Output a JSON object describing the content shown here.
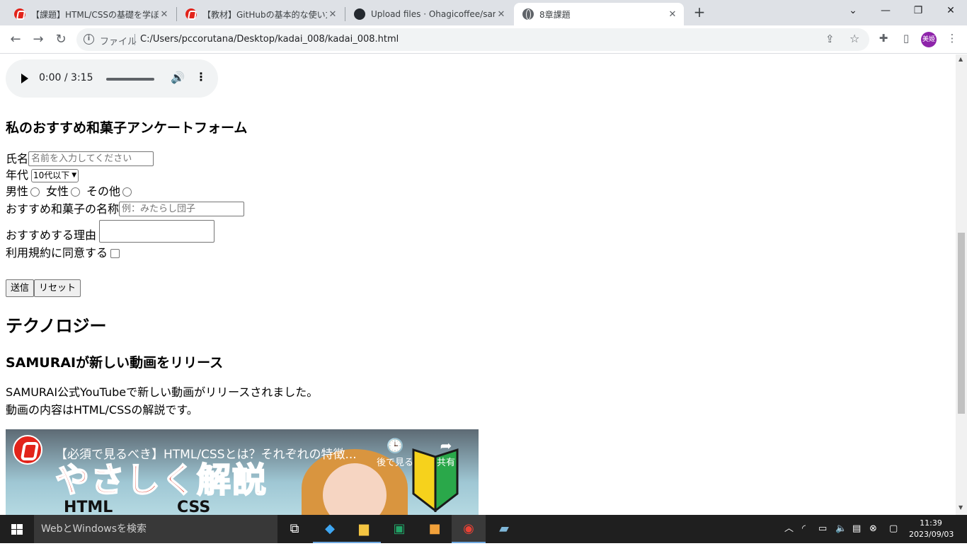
{
  "browser": {
    "tabs": [
      {
        "title": "【課題】HTML/CSSの基礎を学ぼう -",
        "favicon": "samurai-icon"
      },
      {
        "title": "【教材】GitHubの基本的な使い方を",
        "favicon": "samurai-icon"
      },
      {
        "title": "Upload files · Ohagicoffee/samur",
        "favicon": "github-icon"
      },
      {
        "title": "8章課題",
        "favicon": "globe-icon",
        "active": true
      }
    ],
    "address": {
      "scheme_label": "ファイル",
      "url": "C:/Users/pccorutana/Desktop/kadai_008/kadai_008.html"
    },
    "profile_initials": "美姫"
  },
  "audio": {
    "time": "0:00 / 3:15"
  },
  "form": {
    "title": "私のおすすめ和菓子アンケートフォーム",
    "name_label": "氏名",
    "name_placeholder": "名前を入力してください",
    "age_label": "年代",
    "age_selected": "10代以下",
    "gender_options": [
      "男性",
      "女性",
      "その他"
    ],
    "sweet_label": "おすすめ和菓子の名称",
    "sweet_placeholder": "例：みたらし団子",
    "reason_label": "おすすめする理由",
    "agree_label": "利用規約に同意する",
    "submit_label": "送信",
    "reset_label": "リセット"
  },
  "tech": {
    "heading": "テクノロジー",
    "news_title": "SAMURAIが新しい動画をリリース",
    "paragraph_line1": "SAMURAI公式YouTubeで新しい動画がリリースされました。",
    "paragraph_line2": "動画の内容はHTML/CSSの解説です。"
  },
  "video": {
    "title": "【必須で見るべき】HTML/CSSとは？それぞれの特徴...",
    "watch_later": "後で見る",
    "share": "共有",
    "thumbnail_text": "やさしく解説",
    "thumb_label_html": "HTML",
    "thumb_label_css": "CSS"
  },
  "taskbar": {
    "search_placeholder": "WebとWindowsを検索",
    "time": "11:39",
    "date": "2023/09/03"
  },
  "colors": {
    "samurai_red": "#e2231a",
    "taskbar": "#1f1f1f",
    "tabstrip": "#dee1e6"
  }
}
